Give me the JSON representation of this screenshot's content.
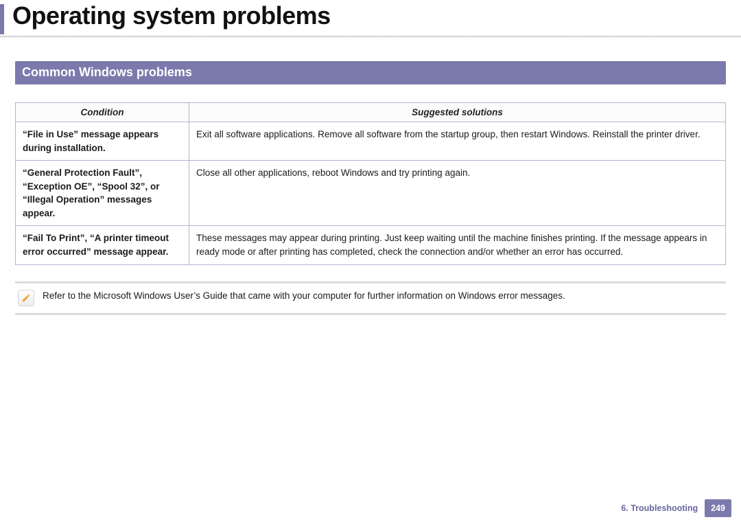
{
  "title": "Operating system problems",
  "section_heading": "Common Windows problems",
  "table": {
    "headers": {
      "condition": "Condition",
      "solution": "Suggested solutions"
    },
    "rows": [
      {
        "condition": "“File in Use” message appears during installation.",
        "solution": "Exit all software applications. Remove all software from the startup group, then restart Windows. Reinstall the printer driver."
      },
      {
        "condition": "“General Protection Fault”, “Exception OE”, “Spool 32”, or “Illegal Operation” messages appear.",
        "solution": "Close all other applications, reboot Windows and try printing again."
      },
      {
        "condition": "“Fail To Print”, “A printer timeout error occurred” message appear.",
        "solution": "These messages may appear during printing. Just keep waiting until the machine finishes printing. If the message appears in ready mode or after printing has completed, check the connection and/or whether an error has occurred."
      }
    ]
  },
  "note_text": "Refer to the Microsoft Windows User’s Guide that came with your computer for further information on Windows error messages.",
  "footer": {
    "chapter": "6.  Troubleshooting",
    "page": "249"
  }
}
